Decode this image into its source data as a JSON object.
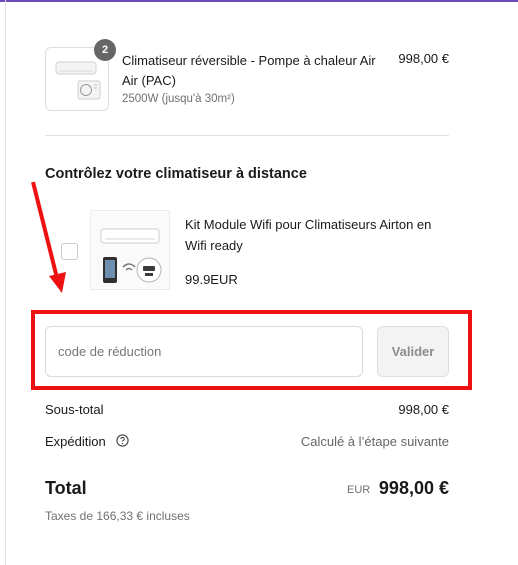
{
  "colors": {
    "accent_bar": "#6b4bb8",
    "annotation_red": "#ee1111",
    "badge_bg": "#666666"
  },
  "cart_item": {
    "quantity": "2",
    "title": "Climatiseur réversible - Pompe à chaleur Air Air (PAC)",
    "variant": "2500W (jusqu'à 30m²)",
    "price": "998,00 €",
    "image_icon": "air-conditioner-icon"
  },
  "upsell": {
    "heading": "Contrôlez votre climatiseur à distance",
    "product_title": "Kit Module Wifi pour Climatiseurs Airton en Wifi ready",
    "product_price": "99.9EUR",
    "checked": false,
    "image_icon": "wifi-module-icon"
  },
  "discount": {
    "placeholder": "code de réduction",
    "value": "",
    "apply_label": "Valider"
  },
  "summary": {
    "subtotal_label": "Sous-total",
    "subtotal_value": "998,00 €",
    "shipping_label": "Expédition",
    "shipping_value": "Calculé à l’étape suivante",
    "shipping_help_icon": "help-circle-icon",
    "total_label": "Total",
    "total_currency": "EUR",
    "total_value": "998,00 €",
    "taxes_note": "Taxes de 166,33 € incluses"
  }
}
